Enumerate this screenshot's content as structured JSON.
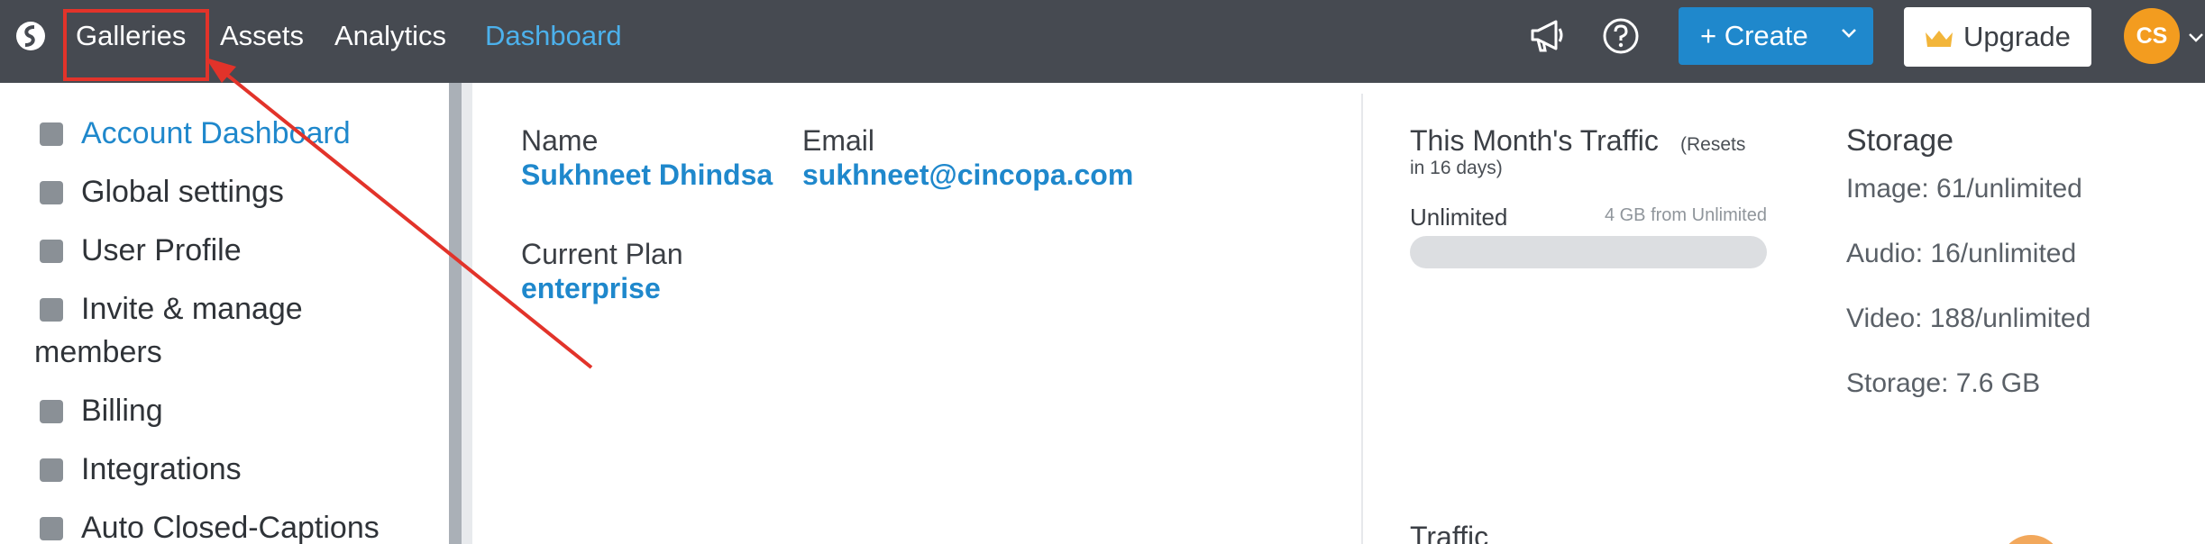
{
  "topbar": {
    "logo_icon": "cincopa-logo-icon",
    "nav": [
      "Galleries",
      "Assets",
      "Analytics",
      "Dashboard"
    ],
    "active_nav": "Dashboard",
    "create_label": "+ Create",
    "upgrade_label": "Upgrade",
    "avatar_initials": "CS",
    "colors": {
      "bar": "#464a51",
      "accent": "#1f88cc",
      "active_link": "#4cb1ec",
      "avatar": "#f39c1f"
    }
  },
  "sidebar": {
    "items": [
      {
        "label": "Account Dashboard",
        "icon": "list-icon",
        "active": true
      },
      {
        "label": "Global settings",
        "icon": "gear-icon",
        "active": false
      },
      {
        "label": "User Profile",
        "icon": "id-card-icon",
        "active": false
      },
      {
        "label": "Invite & manage",
        "label2": "members",
        "icon": "user-icon",
        "active": false
      },
      {
        "label": "Billing",
        "icon": "dollar-icon",
        "active": false
      },
      {
        "label": "Integrations",
        "icon": "at-icon",
        "active": false
      },
      {
        "label": "Auto Closed-Captions",
        "icon": "cc-icon",
        "active": false
      }
    ]
  },
  "account": {
    "name_label": "Name",
    "name_value": "Sukhneet Dhindsa",
    "email_label": "Email",
    "email_value": "sukhneet@cincopa.com",
    "plan_label": "Current Plan",
    "plan_value": "enterprise"
  },
  "traffic": {
    "title": "This Month's Traffic",
    "resets_line1": "(Resets",
    "resets_line2": "in 16 days)",
    "unlimited_label": "Unlimited",
    "usage_text": "4 GB from Unlimited",
    "usage_fraction": 0
  },
  "storage": {
    "title": "Storage",
    "lines": [
      "Image: 61/unlimited",
      "Audio: 16/unlimited",
      "Video: 188/unlimited",
      "Storage: 7.6 GB"
    ]
  },
  "traffic_section_title": "Traffic"
}
